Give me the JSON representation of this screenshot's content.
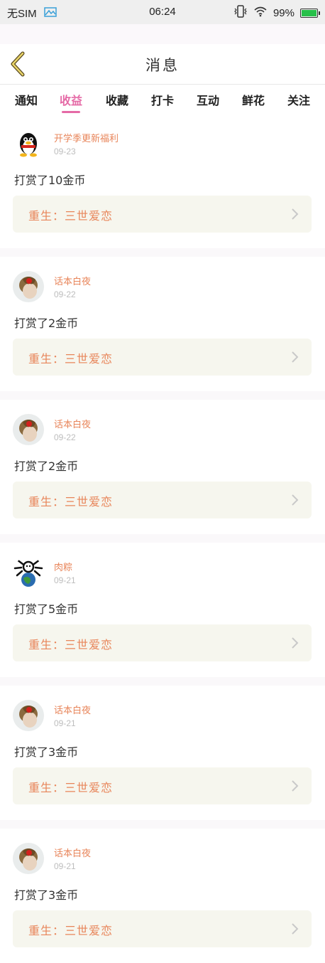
{
  "status_bar": {
    "carrier": "无SIM",
    "time": "06:24",
    "battery": "99%",
    "icons": [
      "image-icon",
      "vibrate-icon",
      "wifi-icon",
      "battery-icon"
    ]
  },
  "header": {
    "title": "消息",
    "back_icon": "chevron-left-icon"
  },
  "tabs": [
    {
      "label": "通知",
      "active": false
    },
    {
      "label": "收益",
      "active": true
    },
    {
      "label": "收藏",
      "active": false
    },
    {
      "label": "打卡",
      "active": false
    },
    {
      "label": "互动",
      "active": false
    },
    {
      "label": "鲜花",
      "active": false
    },
    {
      "label": "关注",
      "active": false
    }
  ],
  "items": [
    {
      "name": "开学季更新福利",
      "date": "09-23",
      "action": "打赏了10金币",
      "book": "重生：三世爱恋",
      "avatar": "penguin-avatar"
    },
    {
      "name": "话本白夜",
      "date": "09-22",
      "action": "打赏了2金币",
      "book": "重生：三世爱恋",
      "avatar": "girl-avatar"
    },
    {
      "name": "话本白夜",
      "date": "09-22",
      "action": "打赏了2金币",
      "book": "重生：三世爱恋",
      "avatar": "girl-avatar"
    },
    {
      "name": "肉粽",
      "date": "09-21",
      "action": "打赏了5金币",
      "book": "重生：三世爱恋",
      "avatar": "globe-avatar"
    },
    {
      "name": "话本白夜",
      "date": "09-21",
      "action": "打赏了3金币",
      "book": "重生：三世爱恋",
      "avatar": "girl-avatar"
    },
    {
      "name": "话本白夜",
      "date": "09-21",
      "action": "打赏了3金币",
      "book": "重生：三世爱恋",
      "avatar": "girl-avatar"
    }
  ],
  "colors": {
    "accent_pink": "#e56aa6",
    "name_orange": "#e8855a",
    "card_bg": "#f6f6ee",
    "battery_green": "#27c04a"
  }
}
